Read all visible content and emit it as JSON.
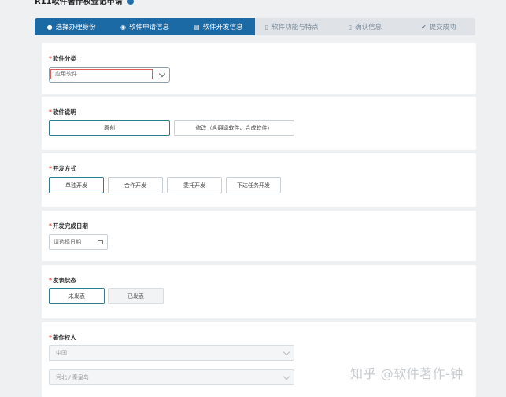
{
  "page": {
    "title": "R11软件著作权登记申请"
  },
  "steps": [
    {
      "label": "选择办理身份",
      "icon": "user-icon",
      "active": true
    },
    {
      "label": "软件申请信息",
      "icon": "location-icon",
      "active": true
    },
    {
      "label": "软件开发信息",
      "icon": "form-icon",
      "active": true
    },
    {
      "label": "软件功能与特点",
      "icon": "document-icon",
      "active": false
    },
    {
      "label": "确认信息",
      "icon": "document-icon",
      "active": false
    },
    {
      "label": "提交成功",
      "icon": "check-circle-icon",
      "active": false
    }
  ],
  "sections": {
    "category": {
      "label": "软件分类",
      "value": "应用软件"
    },
    "description": {
      "label": "软件说明",
      "options": [
        "原创",
        "修改（含翻译软件、合成软件）"
      ],
      "selected": "原创"
    },
    "dev_method": {
      "label": "开发方式",
      "options": [
        "单独开发",
        "合作开发",
        "委托开发",
        "下达任务开发"
      ],
      "selected": "单独开发"
    },
    "completion_date": {
      "label": "开发完成日期",
      "placeholder": "请选择日期"
    },
    "publish_status": {
      "label": "发表状态",
      "options": [
        "未发表",
        "已发表"
      ],
      "selected": "未发表"
    },
    "copyright_holder": {
      "label": "著作权人",
      "country": "中国",
      "region": "河北 / 秦皇岛"
    }
  },
  "watermark": "知乎 @软件著作-钟"
}
